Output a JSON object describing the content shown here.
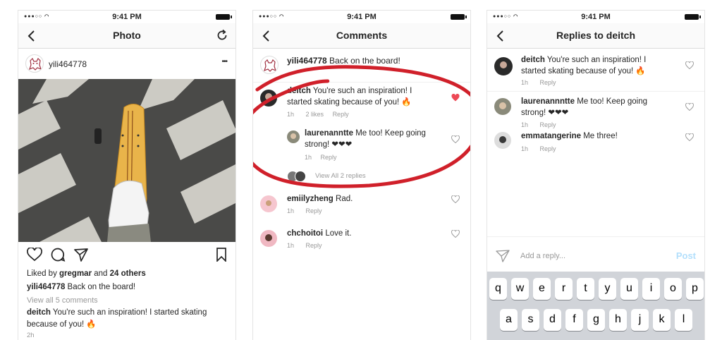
{
  "status": {
    "time": "9:41 PM"
  },
  "photo_screen": {
    "title": "Photo",
    "username": "yili464778",
    "more": "•••",
    "liked_prefix": "Liked by ",
    "liked_user": "gregmar",
    "liked_mid": " and ",
    "liked_count": "24 others",
    "caption_user": "yili464778",
    "caption": " Back on the board!",
    "view_all": "View all 5 comments",
    "comment_user": "deitch",
    "comment_line1": " You're such an inspiration! I started skating",
    "comment_line2": "because of you! 🔥",
    "time": "2h"
  },
  "comments_screen": {
    "title": "Comments",
    "caption_user": "yili464778",
    "caption": " Back on the board!",
    "items": [
      {
        "user": "deitch",
        "line1": " You're such an inspiration! I",
        "line2": "started skating because of you! 🔥",
        "time": "1h",
        "likes": "2 likes",
        "reply": "Reply"
      },
      {
        "user": "laurenanntte",
        "line1": " Me too! Keep going",
        "line2": "strong! ❤❤❤",
        "time": "1h",
        "reply": "Reply"
      },
      {
        "user": "emiilyzheng",
        "line1": " Rad.",
        "time": "1h",
        "reply": "Reply"
      },
      {
        "user": "chchoitoi",
        "line1": " Love it.",
        "time": "1h",
        "reply": "Reply"
      }
    ],
    "view_replies": "View All 2 replies"
  },
  "replies_screen": {
    "title": "Replies to deitch",
    "items": [
      {
        "user": "deitch",
        "line1": "  You're such an inspiration! I",
        "line2": "started skating because of you! 🔥",
        "time": "1h",
        "reply": "Reply"
      },
      {
        "user": "laurenannntte",
        "line1": " Me too! Keep going",
        "line2": "strong! ❤❤❤",
        "time": "1h",
        "reply": "Reply"
      },
      {
        "user": "emmatangerine",
        "line1": " Me three!",
        "time": "1h",
        "reply": "Reply"
      }
    ],
    "input_placeholder": "Add a reply...",
    "post": "Post",
    "keys_row1": [
      "q",
      "w",
      "e",
      "r",
      "t",
      "y",
      "u",
      "i",
      "o",
      "p"
    ],
    "keys_row2": [
      "a",
      "s",
      "d",
      "f",
      "g",
      "h",
      "j",
      "k",
      "l"
    ]
  },
  "colors": {
    "annotation_red": "#d0202a",
    "liked_heart": "#ed4956",
    "post_blue": "#b2dffc"
  },
  "icons": [
    "back-icon",
    "refresh-icon",
    "heart-icon",
    "comment-icon",
    "share-icon",
    "bookmark-icon",
    "send-icon"
  ]
}
